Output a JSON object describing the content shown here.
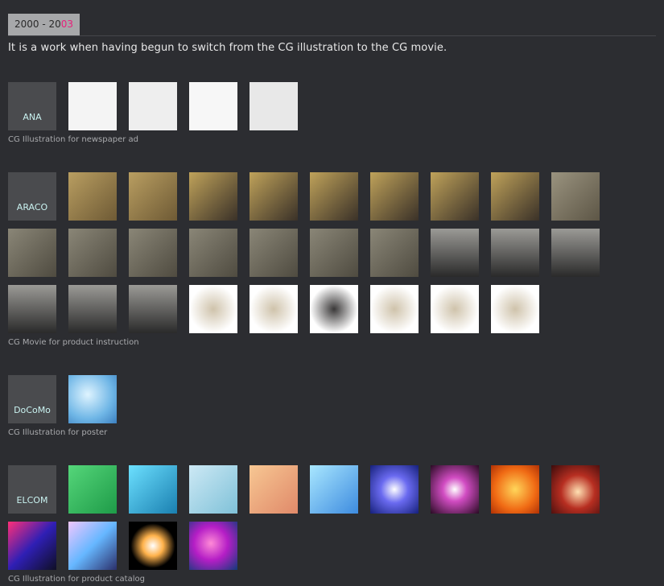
{
  "header": {
    "period_prefix": "2000 - 20",
    "period_highlight": "03"
  },
  "intro": "It is a work when having begun to switch from the CG illustration to the CG movie.",
  "colors": {
    "background": "#2c2d31",
    "tile": "#4a4b4e",
    "highlight": "#e8207a",
    "label": "#c9f2f0"
  },
  "sections": [
    {
      "client": "ANA",
      "caption": "CG Illustration for newspaper ad",
      "rows": [
        [
          "newspaper-diagram-1",
          "newspaper-diagram-2",
          "newspaper-diagram-3",
          "newspaper-diagram-4"
        ]
      ]
    },
    {
      "client": "ARACO",
      "caption": "CG Movie for product instruction",
      "rows": [
        [
          "seat-cargo-1",
          "seat-cargo-2",
          "seat-dummy-1",
          "seat-dummy-2",
          "seat-dummy-3",
          "seat-dummy-4",
          "seat-dummy-5",
          "seat-dummy-6",
          "seat-rear-1"
        ],
        [
          "fold-seat-1",
          "fold-seat-2",
          "fold-seat-3",
          "fold-seat-4",
          "fold-seat-5",
          "fold-seat-6",
          "fold-seat-7",
          "seat-grey-1",
          "seat-grey-2",
          "seat-grey-3"
        ],
        [
          "seat-grey-4",
          "seat-grey-5",
          "seat-grey-6",
          "seat-beige-1",
          "seat-beige-2",
          "seat-black-1",
          "seat-beige-3",
          "seat-beige-4",
          "seat-beige-5"
        ]
      ]
    },
    {
      "client": "DoCoMo",
      "caption": "CG Illustration for poster",
      "rows": [
        [
          "droplet-abstract"
        ]
      ]
    },
    {
      "client": "ELCOM",
      "caption": "CG Illustration for product catalog",
      "rows": [
        [
          "abstract-green",
          "abstract-cyan",
          "abstract-pale-blue",
          "abstract-peach",
          "abstract-sky",
          "abstract-blue-flare",
          "abstract-magenta-burst",
          "abstract-orange",
          "abstract-red-spiral"
        ],
        [
          "abstract-neon-grid",
          "abstract-swirl",
          "abstract-lens-flare",
          "abstract-pink-blue"
        ]
      ]
    }
  ]
}
